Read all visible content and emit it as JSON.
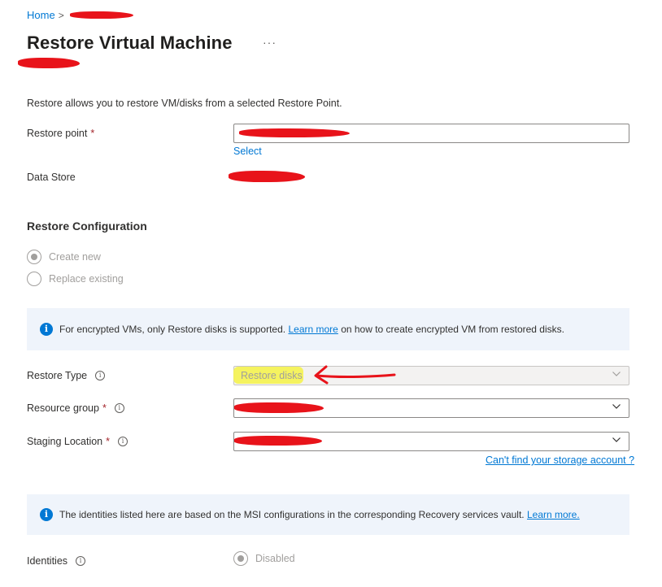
{
  "breadcrumb": {
    "home": "Home",
    "separator": ">"
  },
  "header": {
    "title": "Restore Virtual Machine",
    "more": "···"
  },
  "description": "Restore allows you to restore VM/disks from a selected Restore Point.",
  "restore_point": {
    "label": "Restore point",
    "required": "*",
    "select_link": "Select"
  },
  "data_store": {
    "label": "Data Store"
  },
  "restore_configuration": {
    "title": "Restore Configuration",
    "options": [
      {
        "label": "Create new",
        "checked": true
      },
      {
        "label": "Replace existing",
        "checked": false
      }
    ]
  },
  "encrypt_banner": {
    "text_before": "For encrypted VMs, only Restore disks is supported.",
    "link": "Learn more",
    "text_after": "on how to create encrypted VM from restored disks."
  },
  "restore_type": {
    "label": "Restore Type",
    "value": "Restore disks"
  },
  "resource_group": {
    "label": "Resource group",
    "required": "*"
  },
  "staging_location": {
    "label": "Staging Location",
    "required": "*",
    "help_link": "Can't find your storage account ?"
  },
  "identities_banner": {
    "text": "The identities listed here are based on the MSI configurations in the corresponding Recovery services vault.",
    "link": "Learn more."
  },
  "identities": {
    "label": "Identities",
    "value": "Disabled"
  },
  "icons": {
    "info": "info-icon",
    "chevron": "chevron-down-icon",
    "banner_info": "info-filled-icon"
  },
  "colors": {
    "accent": "#0078d4",
    "annotation": "#e8131a",
    "highlight": "#f5f34f",
    "banner_bg": "#eff4fb"
  }
}
